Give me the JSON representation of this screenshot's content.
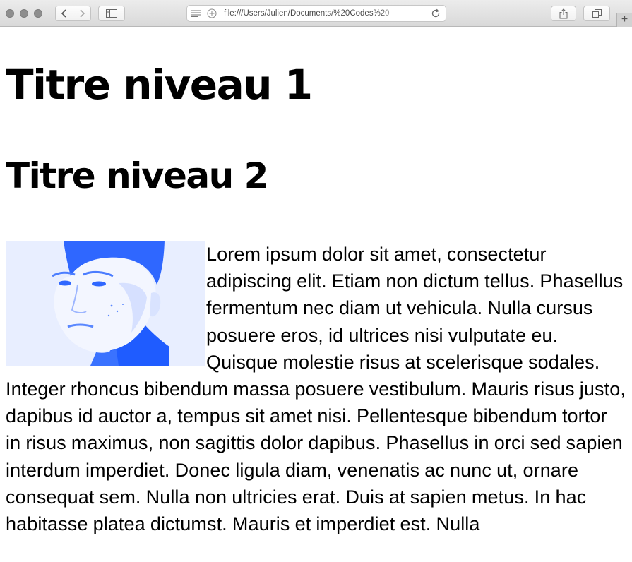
{
  "browser": {
    "url": "file:///Users/Julien/Documents/%20Codes%20",
    "icons": {
      "close": "traffic-light-icon",
      "back": "chevron-left-icon",
      "forward": "chevron-right-icon",
      "sidebar": "sidebar-icon",
      "reader": "reader-lines-icon",
      "add_bookmark": "plus-circle-icon",
      "reload": "reload-icon",
      "share": "share-icon",
      "tabs": "tabs-overview-icon",
      "new_tab": "plus-icon"
    }
  },
  "page": {
    "heading1": "Titre niveau 1",
    "heading2": "Titre niveau 2",
    "image_alt": "portrait-photo",
    "paragraph": "Lorem ipsum dolor sit amet, consectetur adipiscing elit. Etiam non dictum tellus. Phasellus fermentum nec diam ut vehicula. Nulla cursus posuere eros, id ultrices nisi vulputate eu. Quisque molestie risus at scelerisque sodales. Integer rhoncus bibendum massa posuere vestibulum. Mauris risus justo, dapibus id auctor a, tempus sit amet nisi. Pellentesque bibendum tortor in risus maximus, non sagittis dolor dapibus. Phasellus in orci sed sapien interdum imperdiet. Donec ligula diam, venenatis ac nunc ut, ornare consequat sem. Nulla non ultricies erat. Duis at sapien metus. In hac habitasse platea dictumst. Mauris et imperdiet est. Nulla"
  },
  "colors": {
    "image_tint": "#1f5cff",
    "image_light": "#eaf0ff",
    "text": "#000000"
  }
}
